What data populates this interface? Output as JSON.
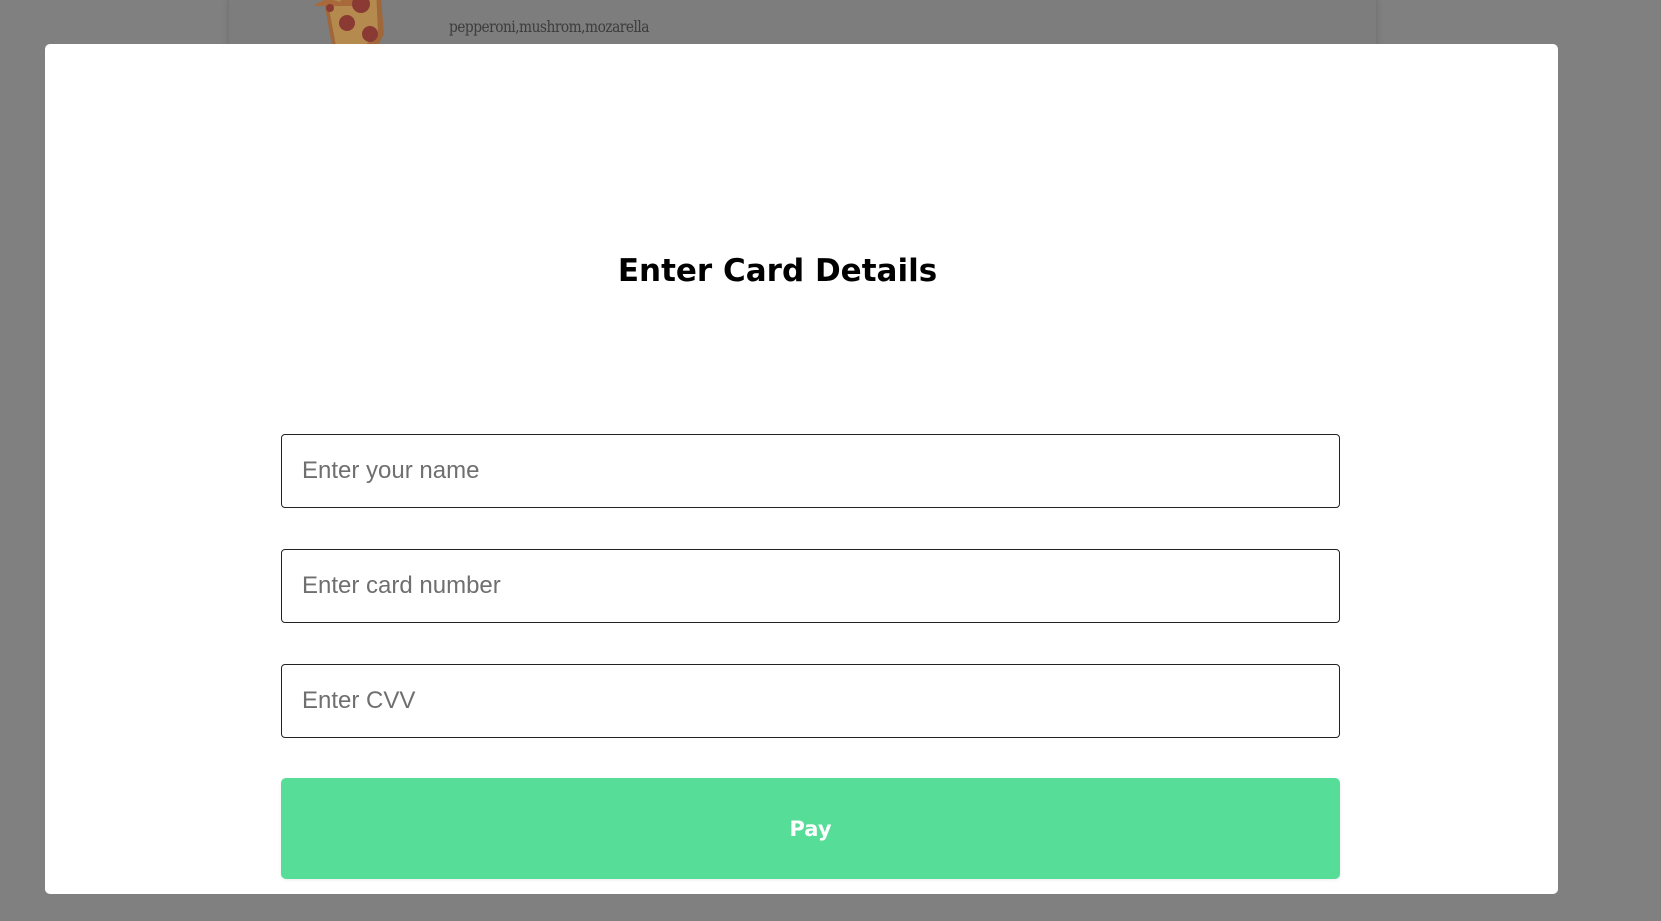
{
  "background": {
    "toppings": "pepperoni,mushrom,mozarella",
    "food_icon": "pizza-slice-icon"
  },
  "modal": {
    "title": "Enter Card Details",
    "fields": {
      "name_placeholder": "Enter your name",
      "card_number_placeholder": "Enter card number",
      "cvv_placeholder": "Enter CVV"
    },
    "pay_label": "Pay"
  },
  "colors": {
    "overlay": "#808080",
    "modal_background": "#ffffff",
    "pay_button": "#56de98",
    "input_border": "#222222"
  }
}
